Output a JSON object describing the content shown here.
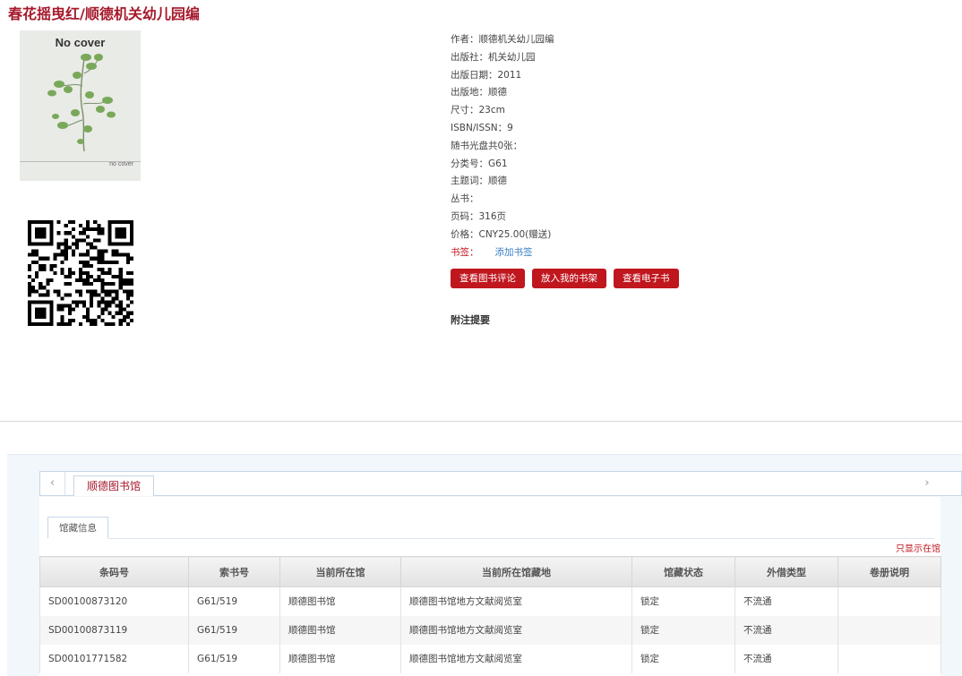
{
  "book": {
    "title": "春花摇曳红/顺德机关幼儿园编",
    "cover": {
      "top_text": "No cover",
      "bottom_text": "no cover"
    }
  },
  "meta": {
    "author": "作者：顺德机关幼儿园编",
    "publisher": "出版社：机关幼儿园",
    "pub_date": "出版日期：2011",
    "pub_place": "出版地：顺德",
    "size": "尺寸：23cm",
    "isbn": "ISBN/ISSN：9",
    "disc": "随书光盘共0张：",
    "class_no": "分类号：G61",
    "subject": "主题词：顺德",
    "series": "丛书：",
    "pages": "页码：316页",
    "price": "价格：CNY25.00(赠送)",
    "bookmark_label": "书签：",
    "bookmark_add": "添加书签"
  },
  "actions": {
    "reviews": "查看图书评论",
    "shelf": "放入我的书架",
    "ebook": "查看电子书"
  },
  "notes_heading": "附注提要",
  "holdings": {
    "library_tab": "顺德图书馆",
    "sub_tab": "馆藏信息",
    "only_in_library": "只显示在馆",
    "columns": [
      "条码号",
      "索书号",
      "当前所在馆",
      "当前所在馆藏地",
      "馆藏状态",
      "外借类型",
      "卷册说明"
    ],
    "rows": [
      [
        "SD00100873120",
        "G61/519",
        "顺德图书馆",
        "顺德图书馆地方文献阅览室",
        "锁定",
        "不流通",
        ""
      ],
      [
        "SD00100873119",
        "G61/519",
        "顺德图书馆",
        "顺德图书馆地方文献阅览室",
        "锁定",
        "不流通",
        ""
      ],
      [
        "SD00101771582",
        "G61/519",
        "顺德图书馆",
        "顺德图书馆地方文献阅览室",
        "锁定",
        "不流通",
        ""
      ]
    ]
  },
  "colors": {
    "brand_red": "#c0161e",
    "title_red": "#a5192b",
    "link_blue": "#3a7fc4"
  },
  "icons": {
    "left_arrow": "chevron-left-icon",
    "right_arrow": "chevron-right-icon"
  }
}
